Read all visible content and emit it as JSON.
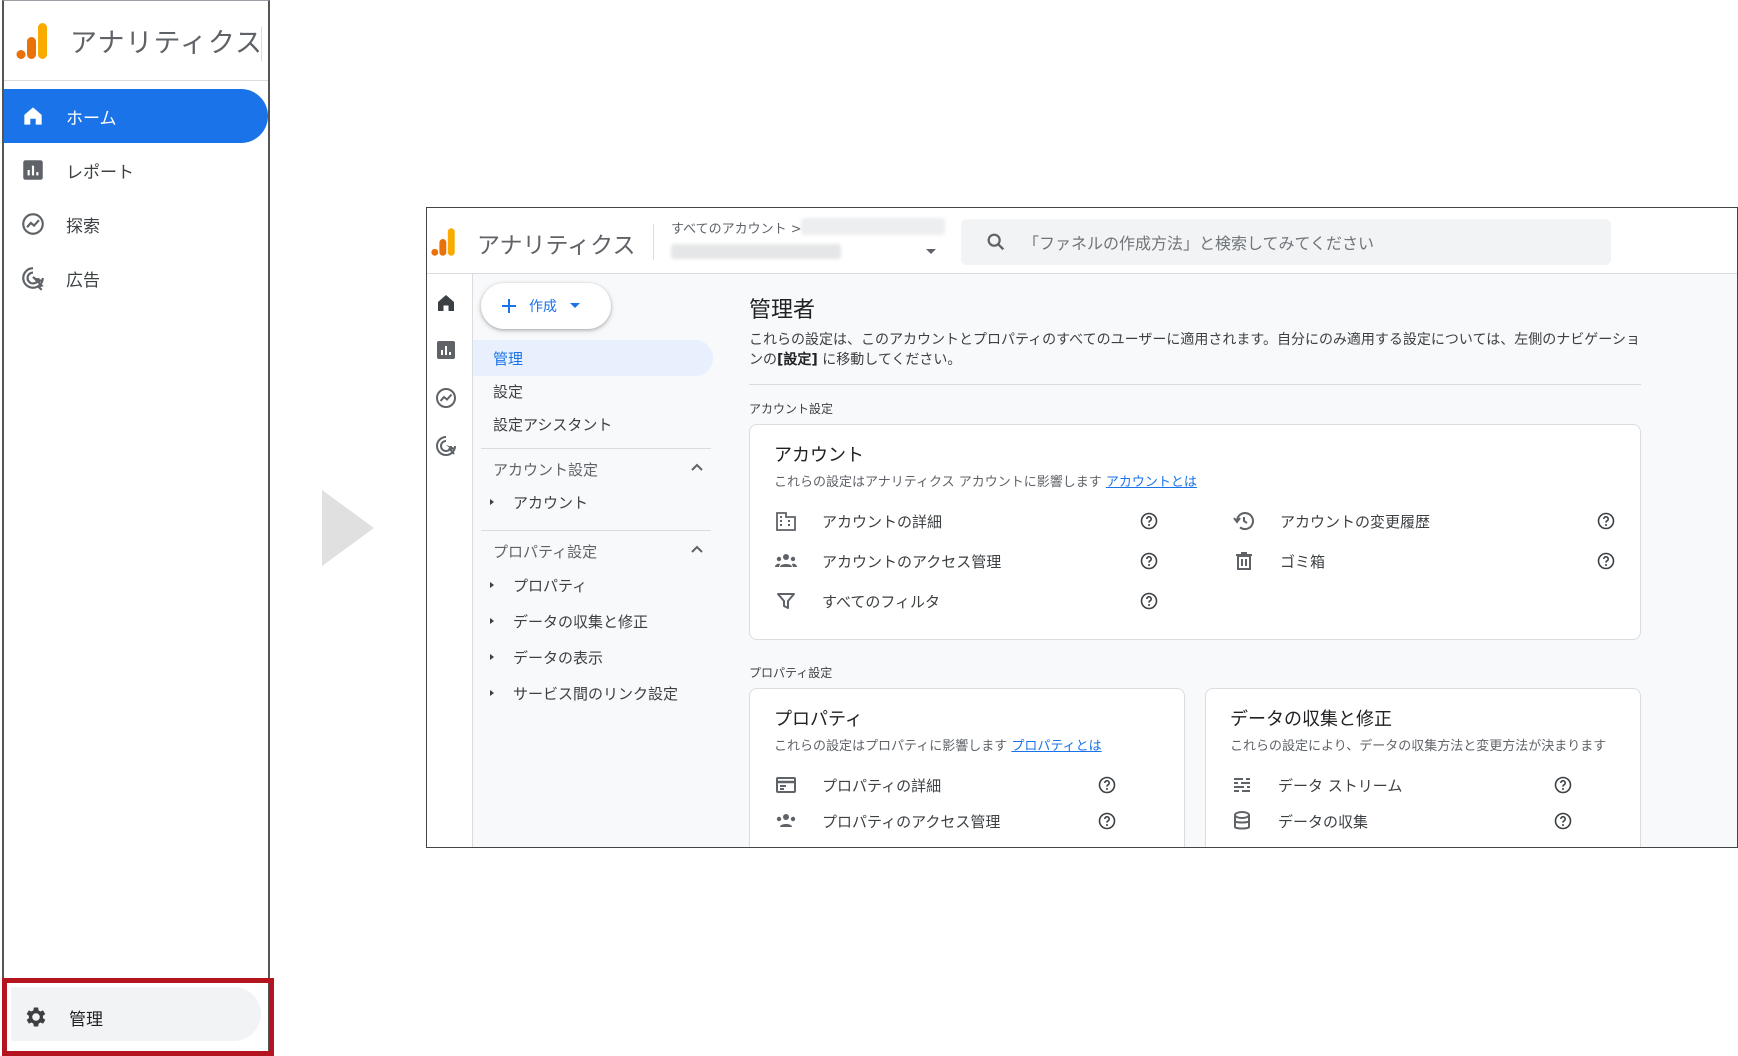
{
  "colors": {
    "accent": "#1a73e8",
    "highlight_border": "#b3141d",
    "logo_orange": "#e8710a",
    "logo_yellow": "#f9ab00"
  },
  "sidebar": {
    "app_title": "アナリティクス",
    "logo_icon": "analytics-logo-icon",
    "items": [
      {
        "label": "ホーム",
        "icon": "home-icon",
        "active": true
      },
      {
        "label": "レポート",
        "icon": "reports-icon",
        "active": false
      },
      {
        "label": "探索",
        "icon": "explore-icon",
        "active": false
      },
      {
        "label": "広告",
        "icon": "advertising-icon",
        "active": false
      }
    ],
    "admin": {
      "label": "管理",
      "icon": "gear-icon"
    }
  },
  "screenshot": {
    "app_title": "アナリティクス",
    "breadcrumb": "すべてのアカウント >",
    "search_placeholder": "「ファネルの作成方法」と検索してみてください",
    "create_button": "作成",
    "left_nav": {
      "items": [
        "管理",
        "設定",
        "設定アシスタント"
      ],
      "groups": [
        {
          "label": "アカウント設定",
          "subitems": [
            "アカウント"
          ]
        },
        {
          "label": "プロパティ設定",
          "subitems": [
            "プロパティ",
            "データの収集と修正",
            "データの表示",
            "サービス間のリンク設定"
          ]
        }
      ]
    },
    "main": {
      "title": "管理者",
      "intro_prefix": "これらの設定は、このアカウントとプロパティのすべてのユーザーに適用されます。自分にのみ適用する設定については、左側のナビゲーションの",
      "intro_bold": "[設定]",
      "intro_suffix": "に移動してください。",
      "account_section_label": "アカウント設定",
      "account_card": {
        "title": "アカウント",
        "desc": "これらの設定はアナリティクス アカウントに影響します",
        "link": "アカウントとは",
        "rows_left": [
          {
            "label": "アカウントの詳細",
            "icon": "building-icon"
          },
          {
            "label": "アカウントのアクセス管理",
            "icon": "people-icon"
          },
          {
            "label": "すべてのフィルタ",
            "icon": "filter-icon"
          }
        ],
        "rows_right": [
          {
            "label": "アカウントの変更履歴",
            "icon": "history-icon"
          },
          {
            "label": "ゴミ箱",
            "icon": "trash-icon"
          }
        ]
      },
      "property_section_label": "プロパティ設定",
      "property_card": {
        "title": "プロパティ",
        "desc": "これらの設定はプロパティに影響します",
        "link": "プロパティとは",
        "rows": [
          {
            "label": "プロパティの詳細",
            "icon": "property-details-icon"
          },
          {
            "label": "プロパティのアクセス管理",
            "icon": "people-icon"
          }
        ]
      },
      "data_card": {
        "title": "データの収集と修正",
        "desc": "これらの設定により、データの収集方法と変更方法が決まります",
        "rows": [
          {
            "label": "データ ストリーム",
            "icon": "data-streams-icon"
          },
          {
            "label": "データの収集",
            "icon": "database-icon"
          }
        ]
      }
    }
  }
}
